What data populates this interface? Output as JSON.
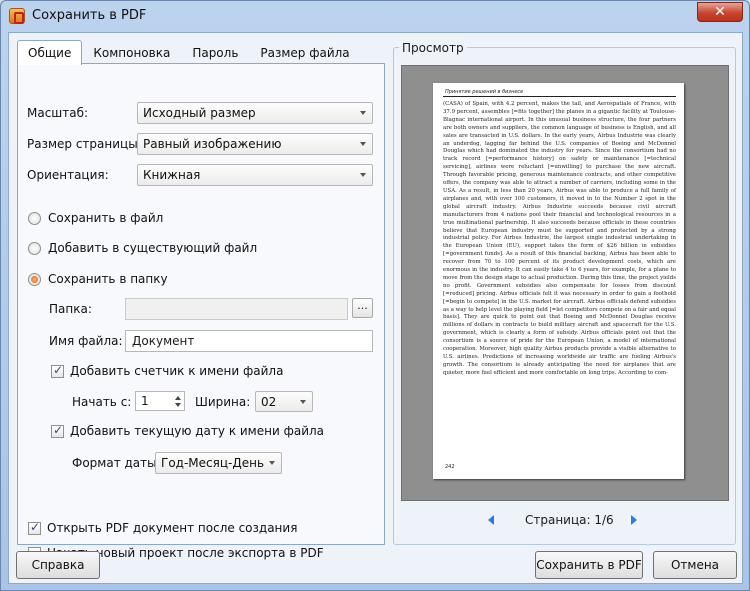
{
  "window": {
    "title": "Сохранить в PDF",
    "close_label": "✕"
  },
  "tabs": [
    {
      "label": "Общие",
      "active": true
    },
    {
      "label": "Компоновка",
      "active": false
    },
    {
      "label": "Пароль",
      "active": false
    },
    {
      "label": "Размер файла",
      "active": false
    }
  ],
  "general": {
    "scale_label": "Масштаб:",
    "scale_value": "Исходный размер",
    "page_size_label": "Размер страницы:",
    "page_size_value": "Равный изображению",
    "orientation_label": "Ориентация:",
    "orientation_value": "Книжная",
    "save_to_file": "Сохранить в файл",
    "add_to_existing": "Добавить в существующий файл",
    "save_to_folder": "Сохранить в папку",
    "folder_label": "Папка:",
    "folder_value": "",
    "browse_label": "...",
    "filename_label": "Имя файла:",
    "filename_value": "Документ",
    "add_counter": "Добавить счетчик к имени файла",
    "start_label": "Начать с:",
    "start_value": "1",
    "width_label": "Ширина:",
    "width_value": "02",
    "add_date": "Добавить текущую дату к имени файла",
    "date_format_label": "Формат даты:",
    "date_format_value": "Год-Месяц-День",
    "open_after": "Открыть PDF документ после создания",
    "new_project": "Начать новый проект после экспорта в PDF"
  },
  "state": {
    "selected_radio": "save_to_folder",
    "add_counter_checked": true,
    "add_date_checked": true,
    "open_after_checked": true,
    "new_project_checked": false
  },
  "preview": {
    "title": "Просмотр",
    "page_header": "Принятие решений в бизнесе",
    "page_text": "(CASA) of Spain, with 4.2 percent, makes the tail, and Aerospatiale of France, with 37.9 percent, assembles [=fits together] the planes in a gigantic facility at Toulouse-Blagnac international airport. In this unusual business structure, the four partners are both owners and suppliers, the common language of business is English, and all sales are transacted in U.S. dollars. In the early years, Airbus Industrie was clearly an underdog, lagging far behind the U.S. companies of Boeing and McDonnel Douglas which had dominated the industry for years. Since the consortium had no track record [=performance history] on safety or maintenance [=technical servicing], airlines were reluctant [=unwilling] to purchase the new aircraft. Through favorable pricing, generous maintenance contracts, and other competitive offers, the company was able to attract a number of carriers, including some in the USA. As a result, in less than 20 years, Airbus was able to produce a full family of airplanes and, with over 100 customers, it moved in to the Number 2 spot in the global aircraft industry. Airbus Industrie succeeds because civil aircraft manufacturers from 4 nations pool their financial and technological resources in a true multinational partnership. It also succeeds because officials in these countries believe that European industry must be supported and protected by a strong industrial policy. For Airbus Industrie, the largest single industrial undertaking in the European Union (EU), support takes the form of $26 billion in subsidies [=government funds]. As a result of this financial backing, Airbus has been able to recover from 70 to 100 percent of its product development costs, which are enormous in the industry. It can easily take 4 to 6 years, for example, for a plane to move from the design stage to actual production. During this time, the project yields no profit. Government subsidies also compensate for losses from discount [=reduced] pricing. Airbus officials felt it was necessary in order to gain a foothold [=begin to compete] in the U.S. market for aircraft. Airbus officials defend subsidies as a way to help level the playing field [=let competitors compete on a fair and equal basis]. They are quick to point out that Boeing and McDonnel Douglas receive millions of dollars in contracts to build military aircraft and spacecraft for the U.S. government, which is clearly a form of subsidy. Airbus officials point out that the consortium is a source of pride for the European Union, a model of international cooperation. Moreover, high quality Airbus products provide a visible alternative to U.S. airlines. Predictions of increasing worldwide air traffic are fueling Airbus's growth. The consortium is already anticipating the need for airplanes that are quieter, more fuel efficient and more comfortable on long trips. According to com-",
    "page_number": "242",
    "page_indicator": "Страница: 1/6"
  },
  "buttons": {
    "help": "Справка",
    "save_pdf": "Сохранить в PDF",
    "cancel": "Отмена"
  }
}
